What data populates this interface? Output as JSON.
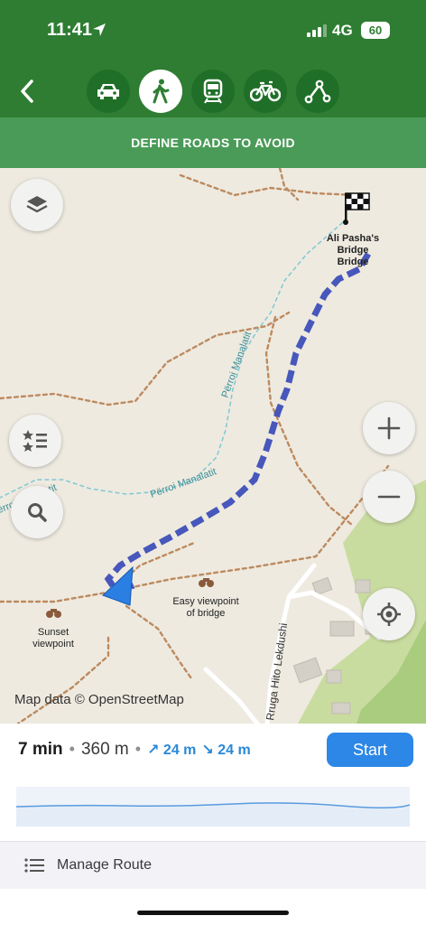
{
  "status": {
    "time": "11:41",
    "network": "4G",
    "battery": "60"
  },
  "nav": {
    "modes": [
      {
        "name": "car",
        "active": false
      },
      {
        "name": "walk",
        "active": true
      },
      {
        "name": "transit",
        "active": false
      },
      {
        "name": "bicycle",
        "active": false
      },
      {
        "name": "direct",
        "active": false
      }
    ]
  },
  "banner": {
    "label": "DEFINE ROADS TO AVOID"
  },
  "map": {
    "destination_label_line1": "Ali Pasha's",
    "destination_label_line2": "Bridge",
    "destination_label_line3": "Bridge",
    "poi_sunset_line1": "Sunset",
    "poi_sunset_line2": "viewpoint",
    "poi_easy_line1": "Easy viewpoint",
    "poi_easy_line2": "of bridge",
    "trail_label_1": "Përroi Manalatit",
    "trail_label_2": "Përroi Manalatit",
    "trail_label_3": "Përroi Manalatit",
    "road_label": "Rruga Hito Lekdushi",
    "attribution": "Map data © OpenStreetMap"
  },
  "route": {
    "time": "7 min",
    "distance": "360 m",
    "ascent": "↗ 24 m",
    "descent": "↘ 24 m",
    "start_label": "Start",
    "manage_label": "Manage Route"
  },
  "colors": {
    "header_green": "#2e7d32",
    "banner_green": "#4a9b57",
    "route_blue": "#3d4fb8",
    "accent_blue": "#2c87e6"
  }
}
